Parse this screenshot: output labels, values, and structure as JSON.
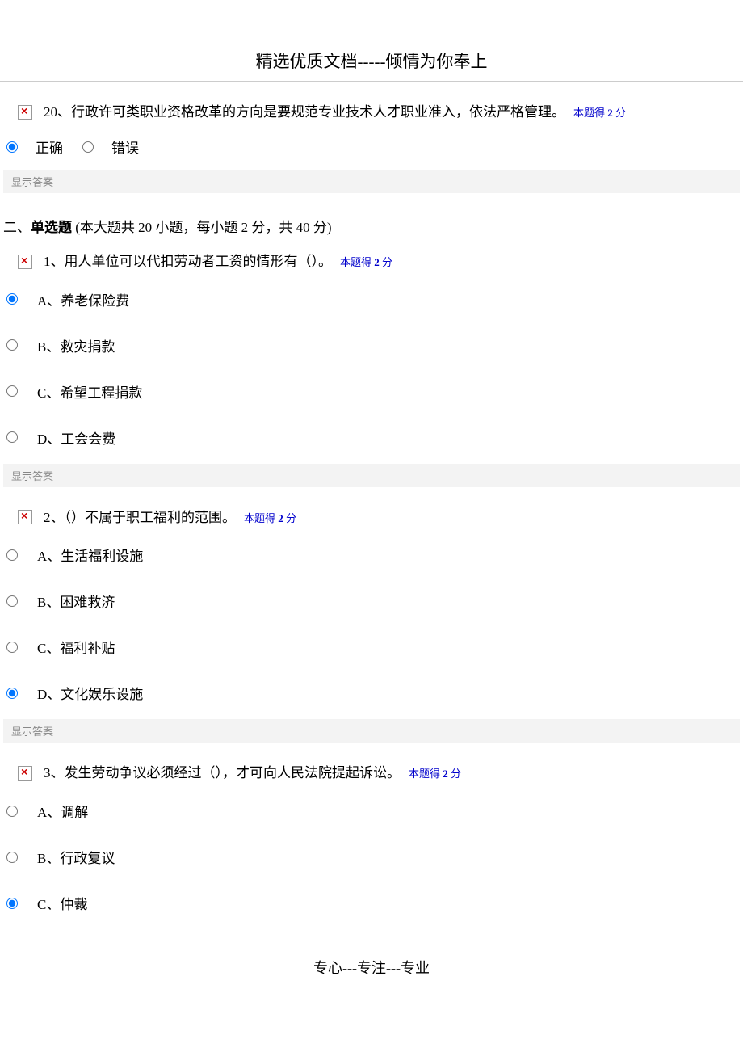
{
  "header": "精选优质文档-----倾情为你奉上",
  "footer": "专心---专注---专业",
  "showAnswerLabel": "显示答案",
  "scorePrefix": "本题得",
  "scoreValue": "2",
  "scoreSuffix": "分",
  "sectionHeader": {
    "prefix": "二、",
    "label": "单选题",
    "detail": " (本大题共 20 小题，每小题 2 分，共 40 分)"
  },
  "q20": {
    "text": "20、行政许可类职业资格改革的方向是要规范专业技术人才职业准入，依法严格管理。",
    "options": {
      "true": "正确",
      "false": "错误"
    }
  },
  "q1": {
    "text": "1、用人单位可以代扣劳动者工资的情形有（）。",
    "options": {
      "a": "A、养老保险费",
      "b": "B、救灾捐款",
      "c": "C、希望工程捐款",
      "d": "D、工会会费"
    }
  },
  "q2": {
    "text": "2、（）不属于职工福利的范围。",
    "options": {
      "a": "A、生活福利设施",
      "b": "B、困难救济",
      "c": "C、福利补贴",
      "d": "D、文化娱乐设施"
    }
  },
  "q3": {
    "text": "3、发生劳动争议必须经过（），才可向人民法院提起诉讼。",
    "options": {
      "a": "A、调解",
      "b": "B、行政复议",
      "c": "C、仲裁"
    }
  }
}
